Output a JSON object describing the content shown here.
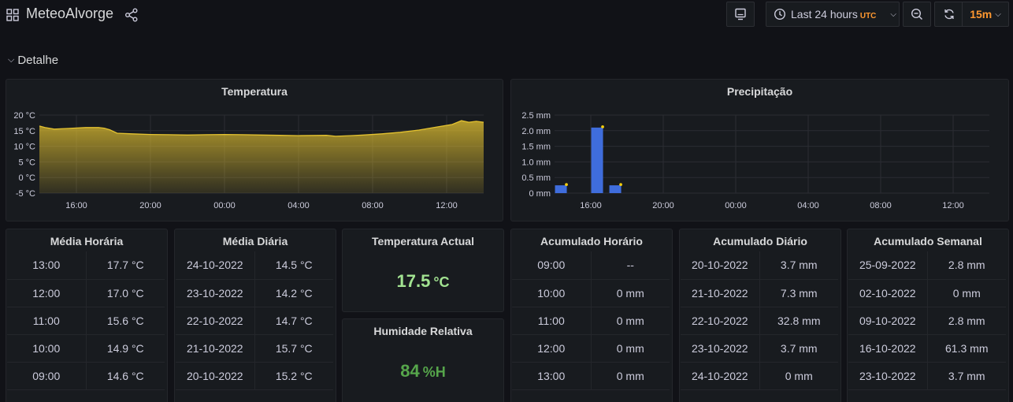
{
  "header": {
    "title": "MeteoAlvorge",
    "time_range": "Last 24 hours",
    "timezone": "UTC",
    "refresh_interval": "15m"
  },
  "row": {
    "title": "Detalhe"
  },
  "colors": {
    "temperature_line": "#e5c330",
    "precip_bar": "#3f6ddc",
    "precip_dot": "#f2cc0c",
    "temp_actual": "#a2e391",
    "humidity": "#56a64b",
    "accent_orange": "#ff9830"
  },
  "temperature_panel": {
    "title": "Temperatura",
    "chart_data": {
      "type": "area",
      "y_ticks": [
        "20 °C",
        "15 °C",
        "10 °C",
        "5 °C",
        "0 °C",
        "-5 °C"
      ],
      "y_tick_values": [
        20,
        15,
        10,
        5,
        0,
        -5
      ],
      "ylim": [
        -5,
        20
      ],
      "x_ticks": [
        "16:00",
        "20:00",
        "00:00",
        "04:00",
        "08:00",
        "12:00"
      ],
      "x_tick_hours": [
        2,
        6,
        10,
        14,
        18,
        22
      ],
      "xlim_hours": [
        0,
        24
      ],
      "grid": true,
      "series": [
        {
          "points": [
            [
              0.0,
              16.5
            ],
            [
              0.3,
              16.0
            ],
            [
              0.8,
              15.5
            ],
            [
              1.5,
              15.7
            ],
            [
              2.5,
              16.0
            ],
            [
              3.2,
              16.0
            ],
            [
              3.5,
              15.8
            ],
            [
              3.8,
              15.3
            ],
            [
              4.2,
              14.2
            ],
            [
              5.0,
              14.0
            ],
            [
              6.0,
              13.8
            ],
            [
              7.0,
              13.7
            ],
            [
              8.0,
              13.6
            ],
            [
              9.0,
              13.7
            ],
            [
              10.0,
              13.8
            ],
            [
              11.0,
              13.7
            ],
            [
              12.0,
              13.6
            ],
            [
              13.0,
              13.5
            ],
            [
              14.0,
              13.4
            ],
            [
              15.5,
              13.5
            ],
            [
              16.0,
              13.2
            ],
            [
              16.8,
              13.4
            ],
            [
              17.5,
              13.6
            ],
            [
              18.5,
              14.0
            ],
            [
              19.5,
              14.5
            ],
            [
              20.5,
              15.2
            ],
            [
              21.5,
              16.2
            ],
            [
              22.3,
              17.0
            ],
            [
              22.8,
              18.2
            ],
            [
              23.2,
              17.7
            ],
            [
              23.6,
              18.0
            ],
            [
              24.0,
              17.7
            ]
          ]
        }
      ]
    }
  },
  "precip_panel": {
    "title": "Precipitação",
    "chart_data": {
      "type": "bar",
      "y_ticks": [
        "2.5 mm",
        "2.0 mm",
        "1.5 mm",
        "1.0 mm",
        "0.5 mm",
        "0 mm"
      ],
      "y_tick_values": [
        2.5,
        2.0,
        1.5,
        1.0,
        0.5,
        0
      ],
      "ylim": [
        0,
        2.5
      ],
      "x_ticks": [
        "16:00",
        "20:00",
        "00:00",
        "04:00",
        "08:00",
        "12:00"
      ],
      "x_tick_hours": [
        2,
        6,
        10,
        14,
        18,
        22
      ],
      "xlim_hours": [
        0,
        24
      ],
      "grid": true,
      "bars": [
        {
          "hour": 0.35,
          "value": 0.25
        },
        {
          "hour": 2.35,
          "value": 2.1
        },
        {
          "hour": 3.35,
          "value": 0.25
        }
      ]
    }
  },
  "media_horaria": {
    "title": "Média Horária",
    "rows": [
      [
        "13:00",
        "17.7 °C"
      ],
      [
        "12:00",
        "17.0 °C"
      ],
      [
        "11:00",
        "15.6 °C"
      ],
      [
        "10:00",
        "14.9 °C"
      ],
      [
        "09:00",
        "14.6 °C"
      ]
    ]
  },
  "media_diaria": {
    "title": "Média Diária",
    "rows": [
      [
        "24-10-2022",
        "14.5 °C"
      ],
      [
        "23-10-2022",
        "14.2 °C"
      ],
      [
        "22-10-2022",
        "14.7 °C"
      ],
      [
        "21-10-2022",
        "15.7 °C"
      ],
      [
        "20-10-2022",
        "15.2 °C"
      ]
    ]
  },
  "temperatura_actual": {
    "title": "Temperatura Actual",
    "value": "17.5",
    "unit": "°C"
  },
  "humidade_relativa": {
    "title": "Humidade Relativa",
    "value": "84",
    "unit": "%H"
  },
  "acumulado_horario": {
    "title": "Acumulado Horário",
    "rows": [
      [
        "09:00",
        "--"
      ],
      [
        "10:00",
        "0 mm"
      ],
      [
        "11:00",
        "0 mm"
      ],
      [
        "12:00",
        "0 mm"
      ],
      [
        "13:00",
        "0 mm"
      ]
    ]
  },
  "acumulado_diario": {
    "title": "Acumulado Diário",
    "rows": [
      [
        "20-10-2022",
        "3.7 mm"
      ],
      [
        "21-10-2022",
        "7.3 mm"
      ],
      [
        "22-10-2022",
        "32.8 mm"
      ],
      [
        "23-10-2022",
        "3.7 mm"
      ],
      [
        "24-10-2022",
        "0 mm"
      ]
    ]
  },
  "acumulado_semanal": {
    "title": "Acumulado Semanal",
    "rows": [
      [
        "25-09-2022",
        "2.8 mm"
      ],
      [
        "02-10-2022",
        "0 mm"
      ],
      [
        "09-10-2022",
        "2.8 mm"
      ],
      [
        "16-10-2022",
        "61.3 mm"
      ],
      [
        "23-10-2022",
        "3.7 mm"
      ]
    ]
  }
}
